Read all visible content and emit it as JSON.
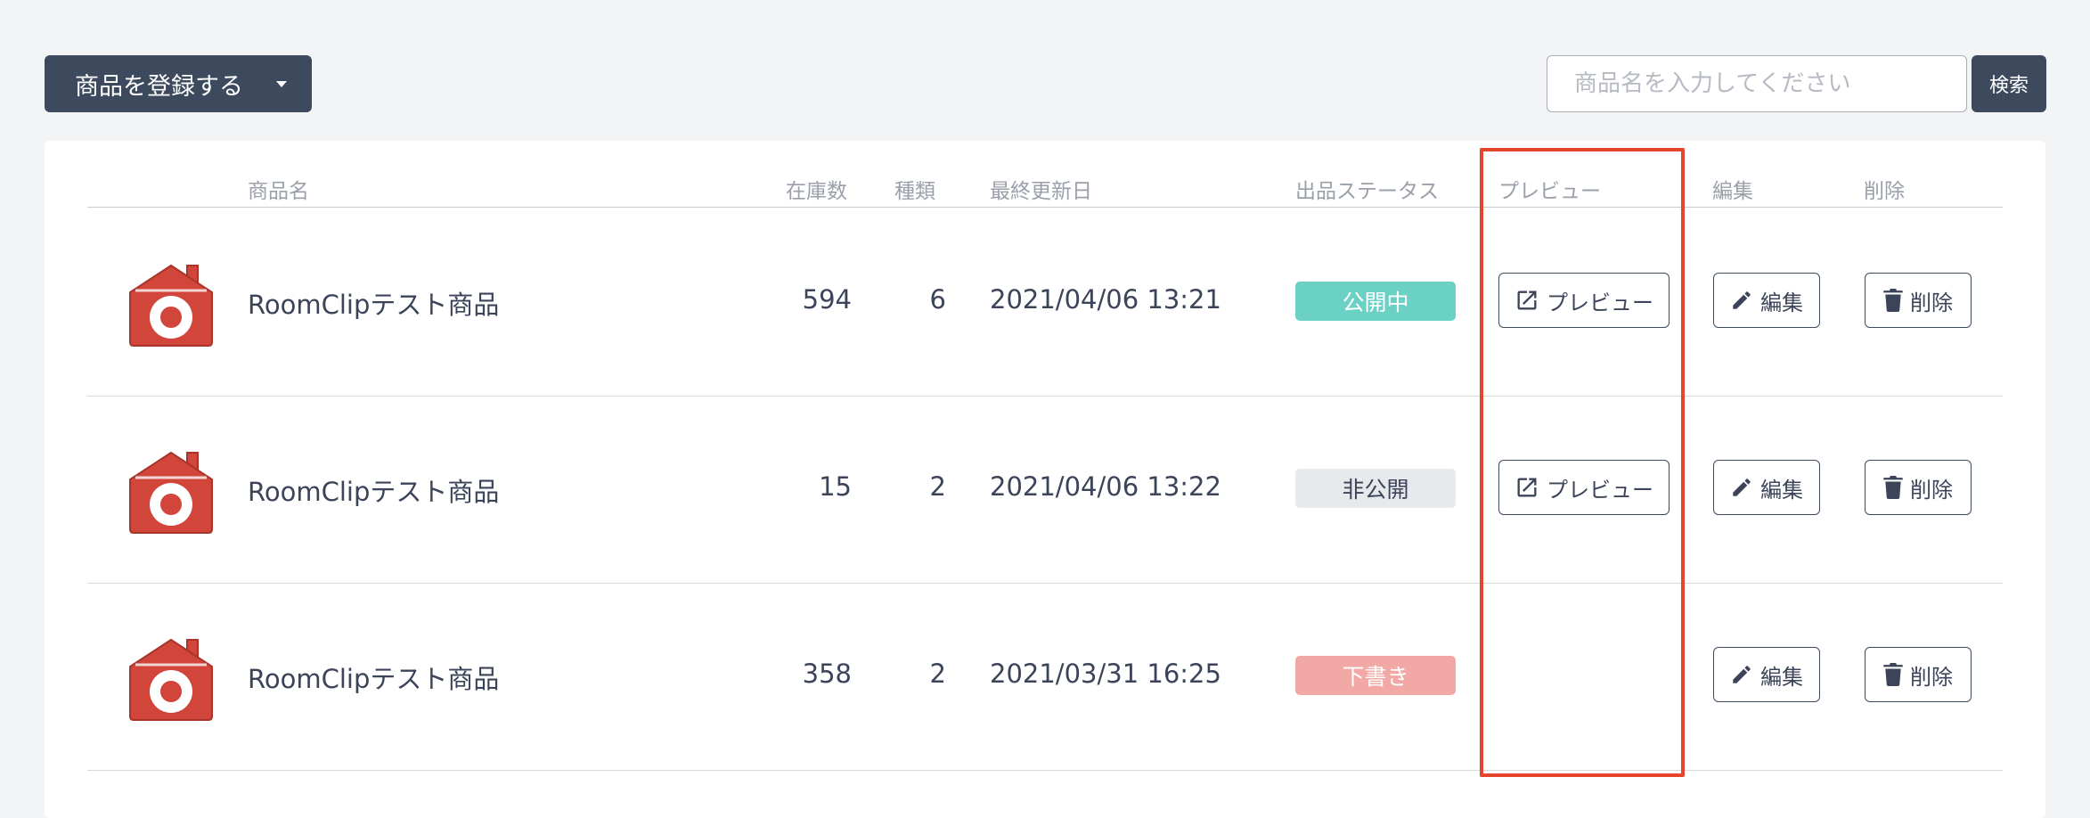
{
  "toolbar": {
    "register_label": "商品を登録する",
    "search_placeholder": "商品名を入力してください",
    "search_value": "",
    "search_button_label": "検索"
  },
  "table": {
    "headers": {
      "name": "商品名",
      "stock": "在庫数",
      "types": "種類",
      "updated": "最終更新日",
      "status": "出品ステータス",
      "preview": "プレビュー",
      "edit": "編集",
      "delete": "削除"
    },
    "rows": [
      {
        "name": "RoomClipテスト商品",
        "stock": "594",
        "types": "6",
        "updated": "2021/04/06 13:21",
        "status": "公開中",
        "status_color": "#6ad1c4",
        "status_text_color": "#ffffff",
        "preview_label": "プレビュー",
        "edit_label": "編集",
        "delete_label": "削除"
      },
      {
        "name": "RoomClipテスト商品",
        "stock": "15",
        "types": "2",
        "updated": "2021/04/06 13:22",
        "status": "非公開",
        "status_color": "#e8e9ec",
        "status_text_color": "#3c4459",
        "preview_label": "プレビュー",
        "edit_label": "編集",
        "delete_label": "削除"
      },
      {
        "name": "RoomClipテスト商品",
        "stock": "358",
        "types": "2",
        "updated": "2021/03/31 16:25",
        "status": "下書き",
        "status_color": "#f2a9a6",
        "status_text_color": "#ffffff",
        "edit_label": "編集",
        "delete_label": "削除"
      }
    ]
  },
  "colors": {
    "primary_dark": "#3d4a5e",
    "highlight": "#e5452b",
    "thumb_red": "#d2453a"
  },
  "icons": {
    "thumbnail": "house-logo-icon",
    "preview": "external-link-icon",
    "edit": "pencil-icon",
    "delete": "trash-icon"
  }
}
